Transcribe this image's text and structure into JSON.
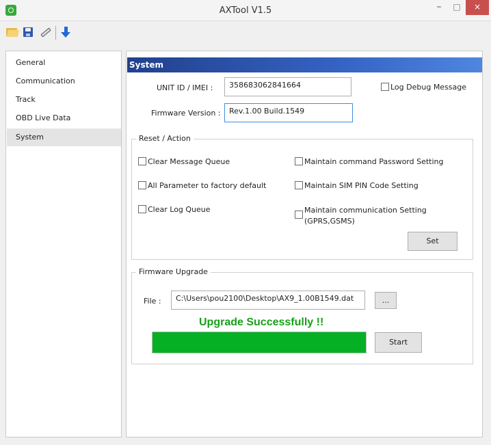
{
  "window": {
    "title": "AXTool V1.5",
    "minimize": "–",
    "maximize": "□",
    "close": "×"
  },
  "toolbar": {
    "icons": [
      "folder-icon",
      "save-icon",
      "edit-icon",
      "download-icon"
    ]
  },
  "nav": {
    "items": [
      {
        "label": "General"
      },
      {
        "label": "Communication"
      },
      {
        "label": "Track"
      },
      {
        "label": "OBD Live Data"
      },
      {
        "label": "System",
        "selected": true
      }
    ]
  },
  "system": {
    "header": "System",
    "unit_id_label": "UNIT ID / IMEI :",
    "unit_id_value": "358683062841664",
    "firmware_label": "Firmware Version :",
    "firmware_value": "Rev.1.00 Build.1549",
    "log_debug_label": "Log Debug Message",
    "log_debug_checked": false
  },
  "reset_action": {
    "title": "Reset / Action",
    "options": [
      {
        "label": "Clear Message Queue",
        "checked": false
      },
      {
        "label": "Maintain command Password Setting",
        "checked": false
      },
      {
        "label": "All Parameter to factory default",
        "checked": false
      },
      {
        "label": "Maintain SIM PIN Code Setting",
        "checked": false
      },
      {
        "label": "Clear Log Queue",
        "checked": false
      },
      {
        "label": "Maintain communication Setting",
        "label_line2": "(GPRS,GSMS)",
        "checked": false
      }
    ],
    "set_button": "Set"
  },
  "firmware_upgrade": {
    "title": "Firmware Upgrade",
    "file_label": "File :",
    "file_path": "C:\\Users\\pou2100\\Desktop\\AX9_1.00B1549.dat",
    "browse_button": "...",
    "status_text": "Upgrade Successfully !!",
    "progress": 1.0,
    "start_button": "Start"
  },
  "colors": {
    "header_start": "#21408c",
    "header_end": "#4f86df",
    "progress": "#06b025",
    "status_text": "#17a017",
    "close_button": "#c7504f"
  }
}
